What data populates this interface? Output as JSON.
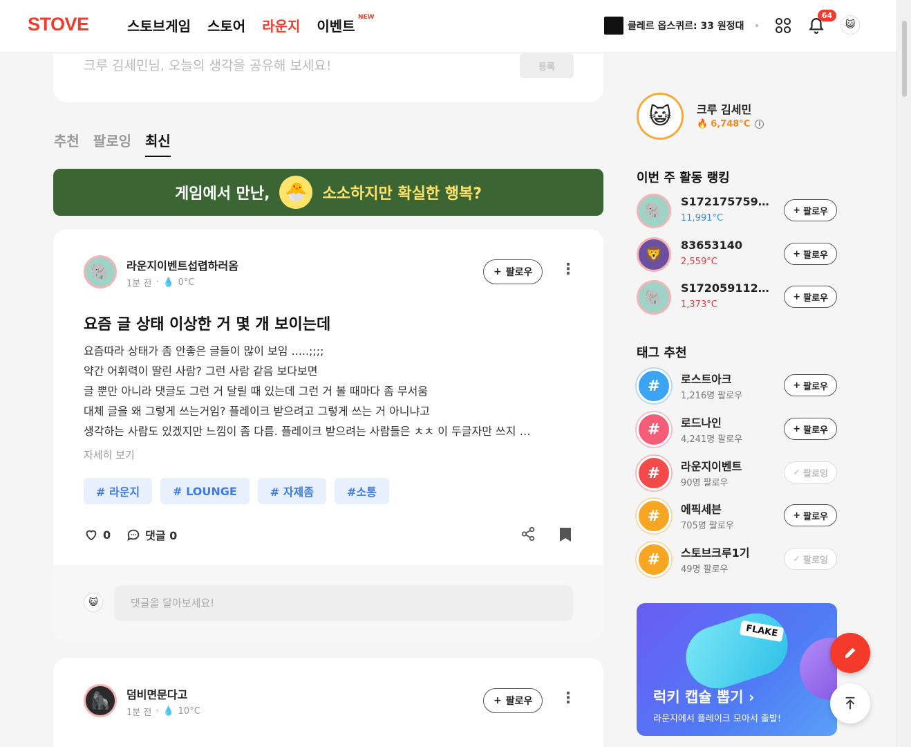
{
  "header": {
    "logo": "STOVE",
    "nav": [
      "스토브게임",
      "스토어",
      "라운지",
      "이벤트"
    ],
    "new_badge": "NEW",
    "game_label": "클레르 옵스퀴르: 33 원정대",
    "notification_count": "64"
  },
  "composer": {
    "placeholder": "크루 김세민님, 오늘의 생각을 공유해 보세요!",
    "submit_label": "등록"
  },
  "feed_tabs": [
    "추천",
    "팔로잉",
    "최신"
  ],
  "banner": {
    "text_left": "게임에서 만난,",
    "text_right": "소소하지만 확실한 행복?"
  },
  "posts": [
    {
      "author": "라운지이벤트섭렵하러옴",
      "time": "1분 전",
      "temp": "0°C",
      "follow_label": "팔로우",
      "title": "요즘 글 상태 이상한 거 몇 개 보이는데",
      "body": [
        "요즘따라 상태가 좀 안좋은 글들이 많이 보임 .....;;;;",
        "약간 어휘력이 딸린 사람? 그런 사람 같음 보다보면",
        "글 뿐만 아니라 댓글도 그런 거 달릴 때 있는데 그런 거 볼 때마다 좀 무서움",
        "대체 글을 왜 그렇게 쓰는거임? 플레이크 받으려고 그렇게 쓰는 거 아니냐고",
        "생각하는 사람도 있겠지만 느낌이 좀 다름. 플레이크 받으려는 사람들은 ㅊㅊ 이 두글자만 쓰지 …"
      ],
      "more_label": "자세히 보기",
      "tags": [
        "# 라운지",
        "# LOUNGE",
        "# 자제좀",
        "#소통"
      ],
      "likes": "0",
      "comments_label": "댓글 0",
      "comment_placeholder": "댓글을 달아보세요!"
    },
    {
      "author": "덤비면문다고",
      "time": "1분 전",
      "temp": "10°C",
      "follow_label": "팔로우"
    }
  ],
  "sidebar": {
    "profile": {
      "name": "크루 김세민",
      "temp": "6,748°C"
    },
    "ranking_title": "이번 주 활동 랭킹",
    "ranking": [
      {
        "name": "S17217575967…",
        "temp": "11,991°C",
        "follow_label": "팔로우"
      },
      {
        "name": "83653140",
        "temp": "2,559°C",
        "follow_label": "팔로우"
      },
      {
        "name": "S17205911277…",
        "temp": "1,373°C",
        "follow_label": "팔로우"
      }
    ],
    "tags_title": "태그 추천",
    "tags": [
      {
        "name": "로스트아크",
        "followers": "1,216명 팔로우",
        "button": "팔로우",
        "following": false,
        "color": "#3ba4f4"
      },
      {
        "name": "로드나인",
        "followers": "4,241명 팔로우",
        "button": "팔로우",
        "following": false,
        "color": "#f45d78"
      },
      {
        "name": "라운지이벤트",
        "followers": "90명 팔로우",
        "button": "팔로잉",
        "following": true,
        "color": "#f24b4b"
      },
      {
        "name": "에픽세븐",
        "followers": "705명 팔로우",
        "button": "팔로우",
        "following": false,
        "color": "#f7a623"
      },
      {
        "name": "스토브크루1기",
        "followers": "49명 팔로우",
        "button": "팔로잉",
        "following": true,
        "color": "#f7a623"
      }
    ],
    "ad": {
      "badge": "FLAKE",
      "title": "럭키 캡슐 뽑기 ›",
      "subtitle": "라운지에서 플레이크 모아서 출발!"
    }
  }
}
